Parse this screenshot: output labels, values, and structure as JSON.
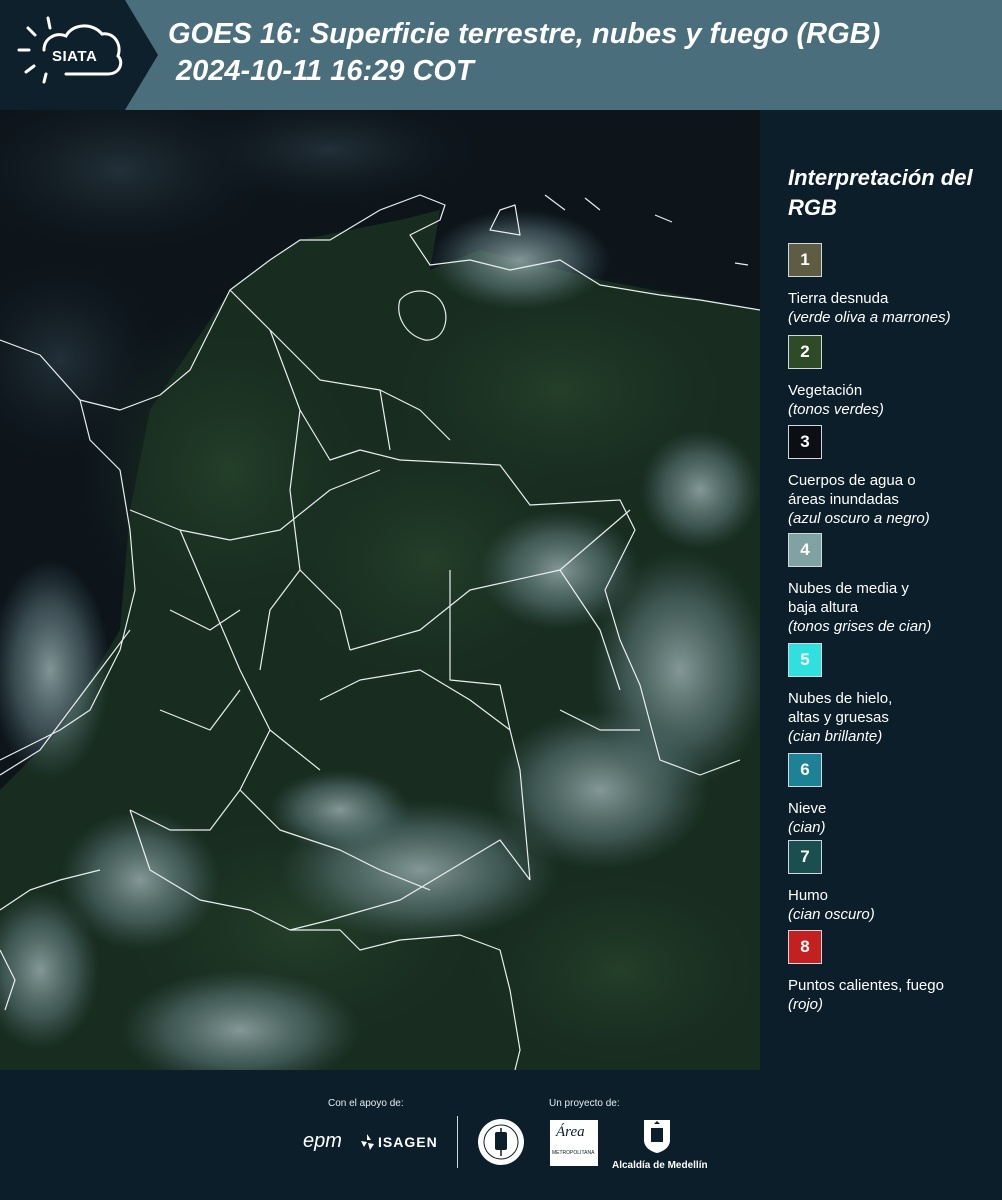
{
  "header": {
    "logo_text": "SIATA",
    "title_line1": "GOES 16: Superficie terrestre, nubes y fuego (RGB)",
    "title_line2": "2024-10-11 16:29 COT"
  },
  "legend": {
    "title": "Interpretación del RGB",
    "items": [
      {
        "num": "1",
        "label": "Tierra desnuda",
        "sub": "(verde oliva a marrones)",
        "color": "#5e5c42"
      },
      {
        "num": "2",
        "label": "Vegetación",
        "sub": "(tonos verdes)",
        "color": "#2f4a26"
      },
      {
        "num": "3",
        "label": "Cuerpos de agua o\náreas inundadas",
        "sub": "(azul oscuro a negro)",
        "color": "#0b0f14"
      },
      {
        "num": "4",
        "label": "Nubes de media y\nbaja altura",
        "sub": "(tonos grises de cian)",
        "color": "#7fa3a3"
      },
      {
        "num": "5",
        "label": "Nubes de hielo,\naltas y gruesas",
        "sub": "(cian brillante)",
        "color": "#2fe0df"
      },
      {
        "num": "6",
        "label": "Nieve",
        "sub": "(cian)",
        "color": "#1d8296"
      },
      {
        "num": "7",
        "label": "Humo",
        "sub": "(cian oscuro)",
        "color": "#1b4e4e"
      },
      {
        "num": "8",
        "label": "Puntos calientes, fuego",
        "sub": "(rojo)",
        "color": "#c3201f"
      }
    ]
  },
  "footer": {
    "support_label": "Con el apoyo de:",
    "project_label": "Un proyecto de:",
    "brand_epm": "epm",
    "brand_isagen": "ISAGEN",
    "brand_area": "Área",
    "brand_area_sub": "METROPOLITANA",
    "brand_alcaldia": "Alcaldía de Medellín"
  },
  "colors": {
    "header_bg": "#4b6e7c",
    "logo_bg": "#0d202b",
    "legend_bg": "#0b1e2a",
    "vegetation": "#1c3320",
    "cloud": "#7d9a9c"
  }
}
